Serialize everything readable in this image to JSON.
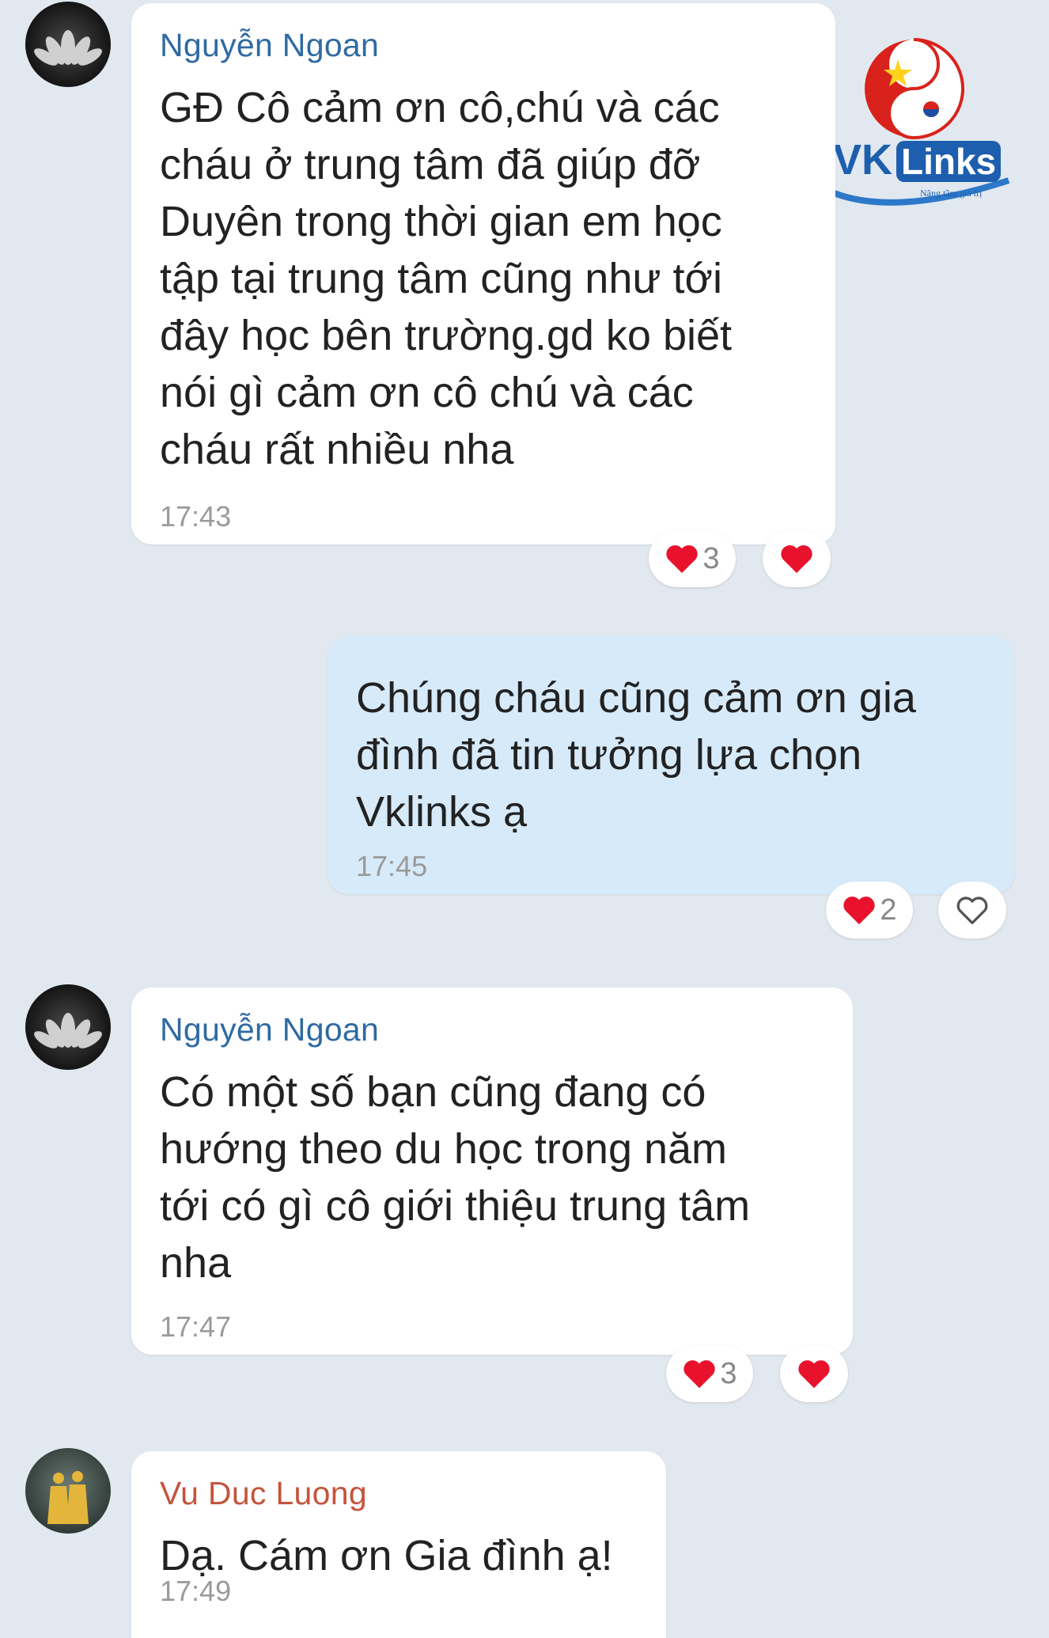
{
  "logo": {
    "brand_left": "VK",
    "brand_right": "Links",
    "tagline": "Nâng tầm giá trị"
  },
  "messages": [
    {
      "sender": "Nguyễn Ngoan",
      "text": "GĐ Cô cảm ơn cô,chú và các\ncháu ở trung tâm đã giúp đỡ\nDuyên trong thời gian em học\ntập  tại trung tâm cũng như tới\nđây học bên trường.gd ko biết\nnói gì cảm ơn cô chú và các\ncháu rất nhiều nha",
      "time": "17:43",
      "reaction_count": "3"
    },
    {
      "sender": "",
      "text": "Chúng cháu cũng cảm ơn gia\nđình đã tin tưởng lựa chọn\nVklinks ạ",
      "time": "17:45",
      "reaction_count": "2"
    },
    {
      "sender": "Nguyễn Ngoan",
      "text": "Có một số bạn cũng đang có\nhướng theo du học trong năm\ntới có gì cô giới thiệu trung tâm\nnha",
      "time": "17:47",
      "reaction_count": "3"
    },
    {
      "sender": "Vu Duc Luong",
      "text": "Dạ. Cám ơn Gia đình ạ!",
      "time": "17:49"
    }
  ],
  "colors": {
    "background": "#e2e8ef",
    "incoming_bubble": "#ffffff",
    "outgoing_bubble": "#d6eafa",
    "sender_blue": "#2f6aa3",
    "sender_orange": "#c5543c",
    "heart_red": "#e8122d"
  },
  "icons": {
    "reaction": "heart-icon",
    "like_outline": "heart-outline-icon"
  }
}
